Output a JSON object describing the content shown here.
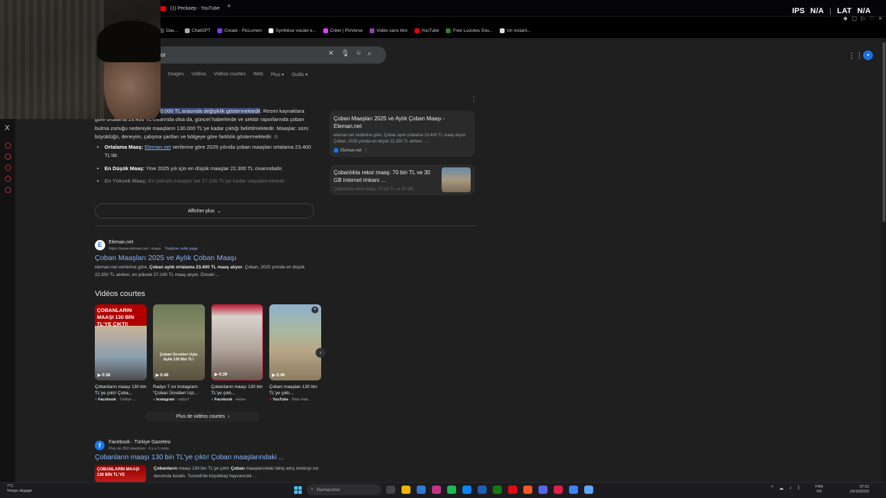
{
  "browser": {
    "tab_title": "(1) Peckaep - YouTube",
    "new_tab": "+",
    "bookmarks": [
      {
        "label": "Das...",
        "color": "#444"
      },
      {
        "label": "ChatGPT",
        "color": "#aaa"
      },
      {
        "label": "Create - PicLumen",
        "color": "#7b3fe4"
      },
      {
        "label": "Synthèse vocale e...",
        "color": "#fff"
      },
      {
        "label": "Créer | PixVerse",
        "color": "#e040fb"
      },
      {
        "label": "Vidéo sans titre",
        "color": "#8e44ad"
      },
      {
        "label": "YouTube",
        "color": "#e00"
      },
      {
        "label": "Free Lucioles Sou...",
        "color": "#2e7d32"
      },
      {
        "label": "Un instant...",
        "color": "#ddd"
      }
    ]
  },
  "hud": {
    "ips_label": "IPS",
    "ips_value": "N/A",
    "lat_label": "LAT",
    "lat_value": "N/A"
  },
  "search": {
    "query": "or",
    "filters": [
      "s",
      "Images",
      "Vidéos",
      "Vidéos courtes",
      "Web",
      "Plus ▾",
      "Outils ▾"
    ]
  },
  "overview": {
    "lead": "ak ",
    "highlight": "ortalama 23.400 TL ile 100.000 TL arasında değişiklik göstermektedir",
    "text": ". Resmi kaynaklara göre ortalama 23.400 TL civarında olsa da, güncel haberlerde ve sektör raporlarında çoban bulma zorluğu nedeniyle maaşların 130.000 TL'ye kadar çıktığı belirtilmektedir. Maaşlar; sürü büyüklüğü, deneyim, çalışma şartları ve bölgeye göre farklılık göstermektedir.",
    "bullets": [
      {
        "label": "Ortalama Maaş:",
        "link": "Eleman.net",
        "text": " verilerine göre 2025 yılında çoban maaşları ortalama 23.400 TL'dir."
      },
      {
        "label": "En Düşük Maaş:",
        "link": "",
        "text": " Yine 2025 yılı için en düşük maaşlar 22.300 TL civarındadır."
      },
      {
        "label": "En Yüksek Maaş:",
        "link": "",
        "text": " En yüksek maaşlar ise 27.100 TL'ye kadar ulaşabilmektedir."
      }
    ],
    "show_more": "Afficher plus"
  },
  "sources": [
    {
      "title": "Çoban Maaşları 2025 ve Aylık Çoban Maaşı - Eleman.net",
      "snippet": "eleman.net verilerine göre, Çoban aylık ortalama 23.400 TL maaş alıyor. Çoban, 2025 yılında en düşük 22.300 TL alırken, ...",
      "site": "Eleman.net"
    },
    {
      "title": "Çobanlıkta rekor maaş: 70 bin TL ve 30 GB internet imkanı ...",
      "snippet": "Çobanlıkta rekor maaş: 70 bin TL ve 30 GB",
      "site": ""
    }
  ],
  "result1": {
    "site": "Eleman.net",
    "url": "https://www.eleman.net › maas",
    "translate": "Traduire cette page",
    "title": "Çoban Maaşları 2025 ve Aylık Çoban Maaşı",
    "snippet_a": "eleman.net verilerine göre, ",
    "snippet_b": "Çoban aylık ortalama 23.400 TL maaş alıyor",
    "snippet_c": ". Çoban, 2025 yılında en düşük 22.300 TL alırken, en yüksek 27.100 TL maaş alıyor. Önceki ..."
  },
  "short_videos": {
    "heading": "Vidéos courtes",
    "more": "Plus de vidéos courtes",
    "items": [
      {
        "duration": "▶ 0:38",
        "caption": "Çobanların maaşı 130 bin TL'ye çıktı! Çoba...",
        "platform": "Facebook",
        "author": "Türkiye ...",
        "overlay": "ÇOBANLARIN MAAŞI 130 BİN TL'YE ÇIKTI!"
      },
      {
        "duration": "▶ 0:46",
        "caption": "Radyo 7 on Instagram: \"Çoban Ücretleri Uçt...",
        "platform": "Instagram",
        "author": "radyo7",
        "overlay": "Çoban Ücretleri Uçtu Aylık 130 Bin TL!"
      },
      {
        "duration": "▶ 0:39",
        "caption": "Çobanların maaşı 130 bin TL'ye çıktı...",
        "platform": "Facebook",
        "author": "Haber",
        "overlay": ""
      },
      {
        "duration": "▶ 0:46",
        "caption": "Çoban maaşları 130 bin TL'ye çıktı...",
        "platform": "YouTube",
        "author": "İhlas Hab...",
        "overlay": ""
      }
    ]
  },
  "result2": {
    "site": "Facebook · Türkiye Gazetesi",
    "meta": "Plus de 250 réactions · il y a 1 mois",
    "title": "Çobanların maaşı 130 bin TL'ye çıktı! Çoban maaşlarındaki ...",
    "thumb_text": "ÇOBANLARIN MAAŞI 130 BİN TL'YE",
    "snippet_a": "Çobanların",
    "snippet_b": " maaşı 130 bin TL'ye çıktı! ",
    "snippet_c": "Çoban",
    "snippet_d": " maaşlarındaki fahiş artış üreticiyi zor durumda bıraktı. Tunceli'de küçükbaş hayvancılık ..."
  },
  "taskbar": {
    "weather_temp": "7°C",
    "weather_desc": "Temps dégagé",
    "search_placeholder": "Rechercher",
    "lang_a": "FRA",
    "lang_b": "FR",
    "time": "07:31",
    "date": "24/10/2025",
    "app_colors": [
      "#444",
      "#f0b400",
      "#2d7ad6",
      "#c13584",
      "#1db954",
      "#0a84ff",
      "#1a5fb4",
      "#107c10",
      "#e50914",
      "#ff5722",
      "#5865f2",
      "#e11d48",
      "#3b82f6",
      "#60a5fa"
    ]
  }
}
